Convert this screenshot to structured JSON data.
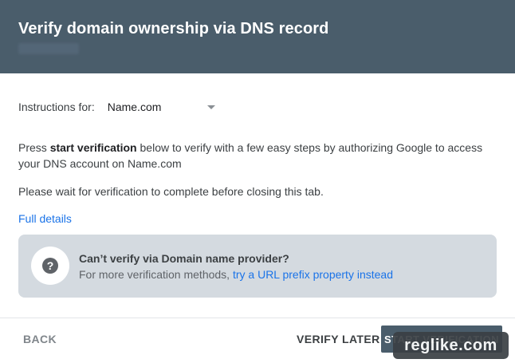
{
  "dialog": {
    "title": "Verify domain ownership via DNS record"
  },
  "instructions": {
    "label": "Instructions for:",
    "selected_provider": "Name.com"
  },
  "body": {
    "para1_prefix": "Press ",
    "para1_bold": "start verification",
    "para1_suffix": " below to verify with a few easy steps by authorizing Google to access your DNS account on Name.com",
    "para2": "Please wait for verification to complete before closing this tab.",
    "full_details_link": "Full details"
  },
  "help_box": {
    "icon": "question-icon",
    "title": "Can’t verify via Domain name provider?",
    "text_prefix": "For more verification methods, ",
    "link_text": "try a URL prefix property instead"
  },
  "footer": {
    "back_label": "BACK",
    "verify_later_label": "VERIFY LATER",
    "start_label": "START VERIFICATION"
  },
  "watermark": "reglike.com",
  "colors": {
    "header_bg": "#4a5d6b",
    "link": "#1a73e8",
    "help_box_bg": "#d4dae0"
  }
}
